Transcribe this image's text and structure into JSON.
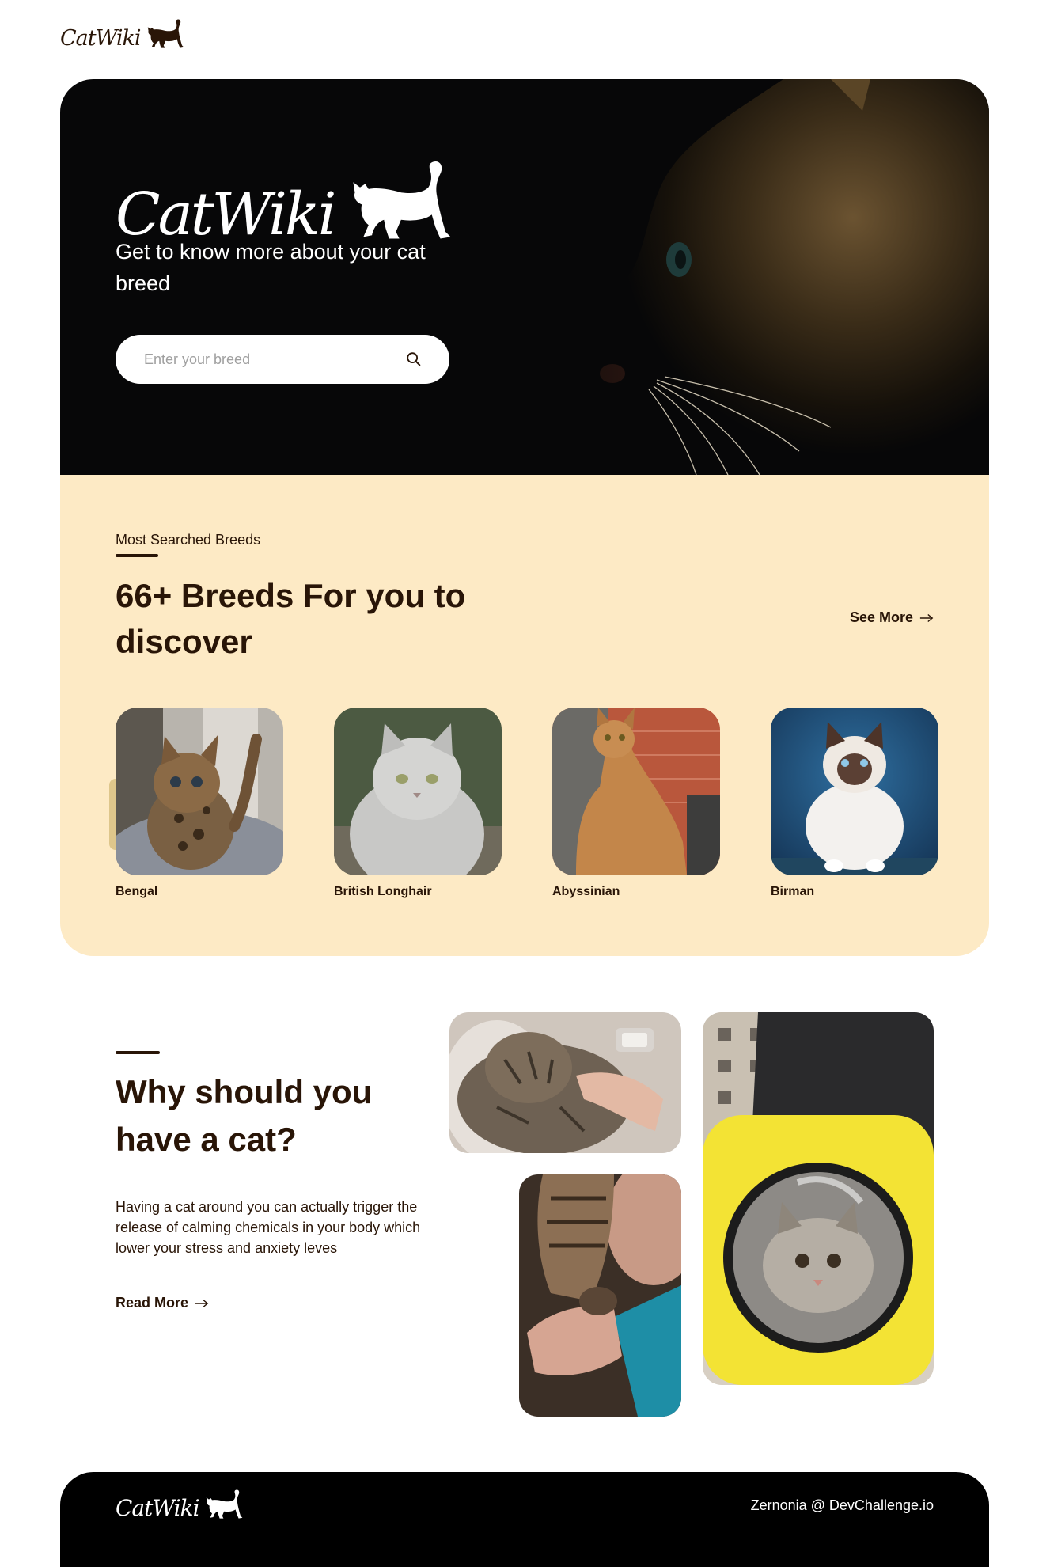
{
  "brand": {
    "name": "CatWiki"
  },
  "hero": {
    "tagline": "Get to know more about your cat breed",
    "search": {
      "placeholder": "Enter your breed",
      "value": ""
    }
  },
  "breeds": {
    "eyebrow": "Most Searched Breeds",
    "heading": "66+ Breeds For you to discover",
    "see_more": "See More",
    "items": [
      {
        "name": "Bengal"
      },
      {
        "name": "British Longhair"
      },
      {
        "name": "Abyssinian"
      },
      {
        "name": "Birman"
      }
    ]
  },
  "why": {
    "heading": "Why should you have a cat?",
    "text": "Having a cat around you can actually trigger the release of calming chemicals in your body which lower your stress and anxiety leves",
    "read_more": "Read More"
  },
  "footer": {
    "credit": "Zernonia @ DevChallenge.io"
  },
  "icons": {
    "brand": "cat-silhouette-icon",
    "search": "search-icon",
    "arrow": "arrow-right-icon"
  },
  "colors": {
    "hero_bg": "#070708",
    "breeds_bg": "#fdeac5",
    "text": "#291507",
    "accent_yellow": "#f2d633"
  }
}
